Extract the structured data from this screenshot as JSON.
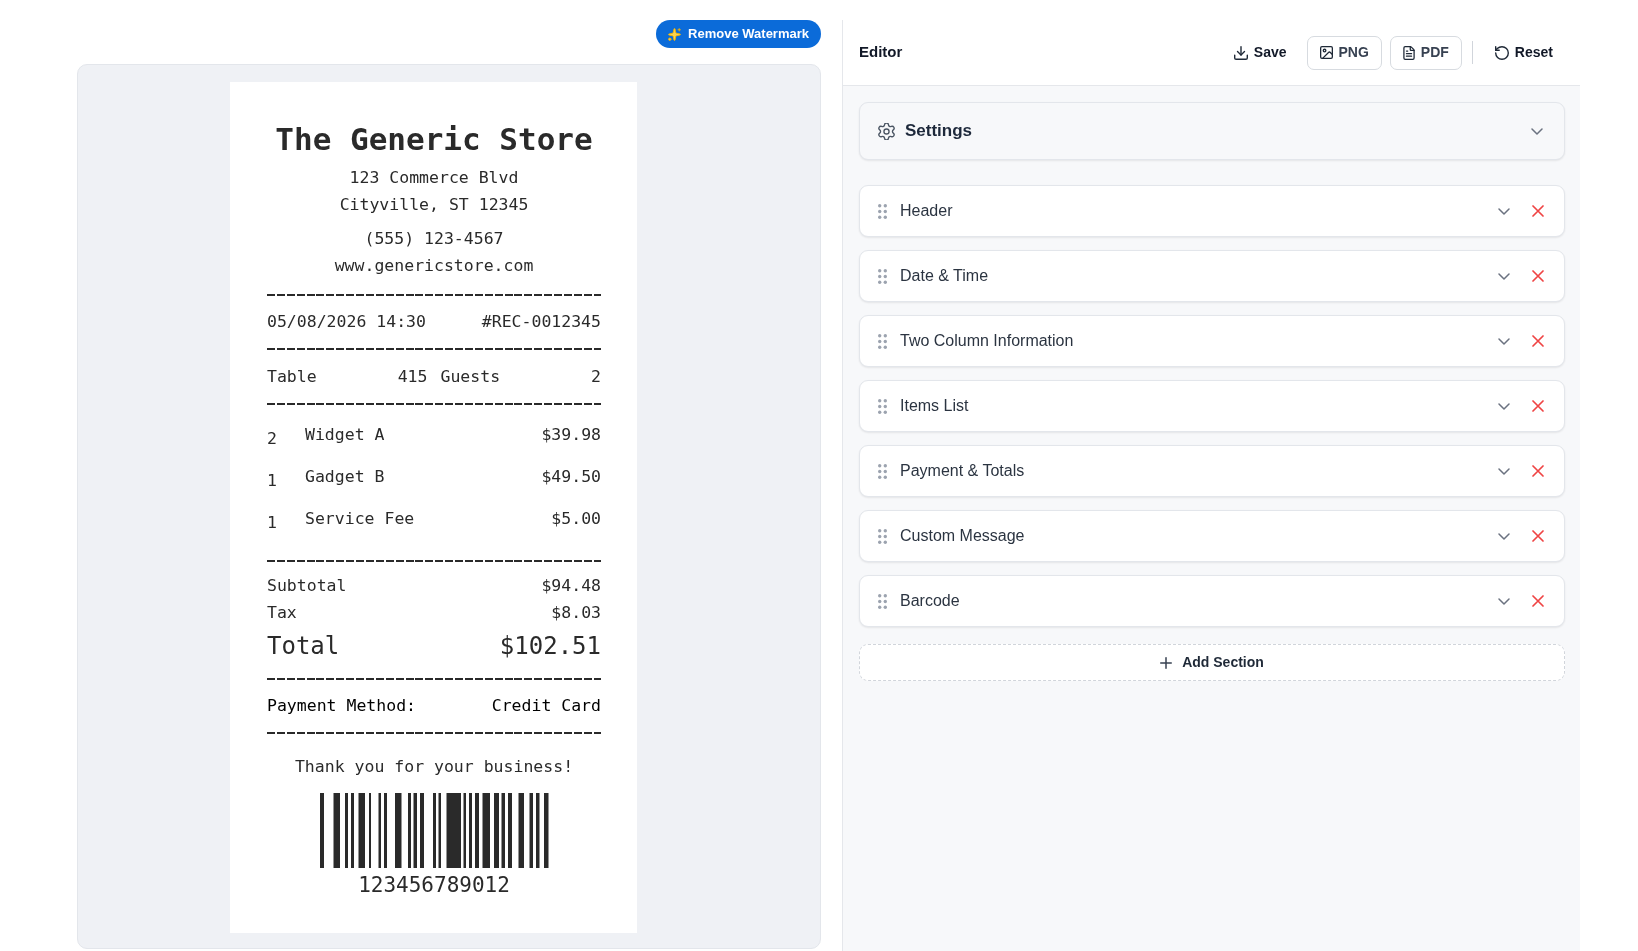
{
  "toolbar": {
    "remove_watermark_button": "Remove Watermark"
  },
  "receipt": {
    "store_name": "The Generic Store",
    "address_lines": [
      "123 Commerce Blvd",
      "Cityville, ST 12345"
    ],
    "phone": "(555) 123-4567",
    "website": "www.genericstore.com",
    "date_time": "05/08/2026 14:30",
    "receipt_number": "#REC-0012345",
    "info": [
      {
        "label": "Table",
        "value": "415"
      },
      {
        "label": "Guests",
        "value": "2"
      }
    ],
    "items": [
      {
        "qty": "2",
        "name": "Widget A",
        "price": "$39.98"
      },
      {
        "qty": "1",
        "name": "Gadget B",
        "price": "$49.50"
      },
      {
        "qty": "1",
        "name": "Service Fee",
        "price": "$5.00"
      }
    ],
    "subtotal": {
      "label": "Subtotal",
      "value": "$94.48"
    },
    "tax": {
      "label": "Tax",
      "value": "$8.03"
    },
    "total": {
      "label": "Total",
      "value": "$102.51"
    },
    "payment": {
      "label": "Payment Method:",
      "value": "Credit Card"
    },
    "message": "Thank you for your business!",
    "barcode": {
      "number": "123456789012"
    }
  },
  "editor": {
    "title": "Editor",
    "actions": [
      {
        "label": "Save",
        "kind": "plain"
      },
      {
        "label": "PNG",
        "kind": "outlined"
      },
      {
        "label": "PDF",
        "kind": "outlined"
      },
      {
        "label": "Reset",
        "kind": "plain"
      }
    ],
    "settings": {
      "title": "Settings",
      "expanded": false
    },
    "sections": [
      {
        "title": "Header",
        "expanded": false
      },
      {
        "title": "Date & Time",
        "expanded": false
      },
      {
        "title": "Two Column Information",
        "expanded": false
      },
      {
        "title": "Items List",
        "expanded": false
      },
      {
        "title": "Payment & Totals",
        "expanded": false
      },
      {
        "title": "Custom Message",
        "expanded": false
      },
      {
        "title": "Barcode",
        "expanded": false
      }
    ],
    "add_section": "Add Section"
  }
}
